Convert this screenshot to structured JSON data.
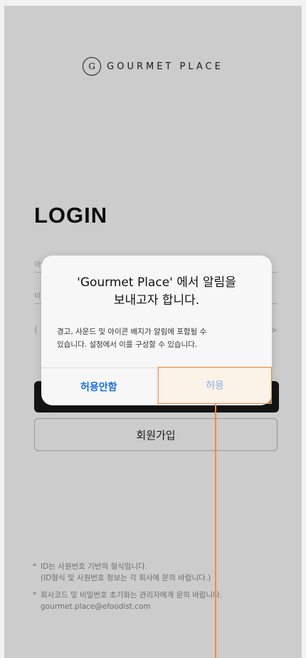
{
  "brand": {
    "logo_glyph": "G",
    "name": "GOURMET PLACE"
  },
  "login": {
    "title": "LOGIN",
    "id_placeholder": "아이디 입력",
    "pw_placeholder": "비",
    "company_left": "(",
    "company_right": ">",
    "signup_label": "회원가입"
  },
  "notes": [
    {
      "bullet": "*",
      "lines": [
        "ID는 사원번호 기반의 형식입니다.",
        "(ID형식 및 사원번호 정보는 각 회사에 문의 바랍니다.)"
      ]
    },
    {
      "bullet": "*",
      "lines": [
        "회사코드 및 비밀번호 초기화는 관리자에게 문의 바랍니다.",
        "gourmet.place@efoodist.com"
      ]
    }
  ],
  "alert": {
    "title_line1": "'Gourmet Place' 에서 알림을",
    "title_line2": "보내고자 합니다.",
    "message_line1": "경고, 사운드 및 아이콘 배지가 알림에 포함될 수",
    "message_line2": "있습니다. 설정에서 이를 구성할 수 있습니다.",
    "deny_label": "허용안함",
    "allow_label": "허용"
  },
  "colors": {
    "accent": "#1a6fe0",
    "highlight": "#f08a3c"
  }
}
